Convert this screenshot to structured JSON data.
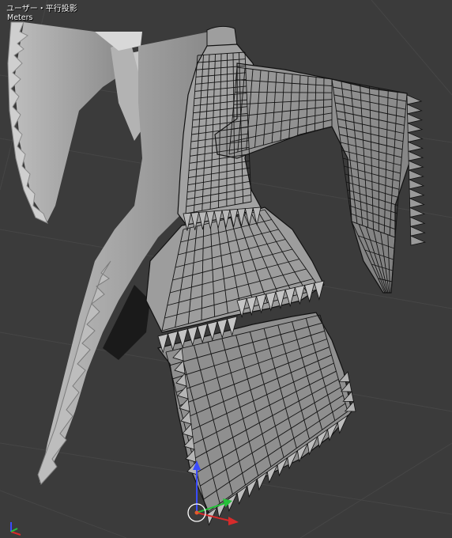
{
  "viewport": {
    "view_name": "ユーザー・平行投影",
    "units": "Meters",
    "background_color": "#3b3b3b",
    "grid_color": "#474747"
  },
  "model": {
    "name": "dress-mesh",
    "shaded_color": "#9a9a9a",
    "edit_side_color": "#8d8d8d",
    "wire_color": "#121212",
    "display": "half-wireframe"
  },
  "gizmo": {
    "x_color": "#d62b2b",
    "y_color": "#26c13a",
    "z_color": "#3a4cff",
    "cursor": "3d-cursor-icon"
  },
  "corner_axes": {
    "x_color": "#d62b2b",
    "y_color": "#26c13a",
    "z_color": "#3a4cff"
  }
}
